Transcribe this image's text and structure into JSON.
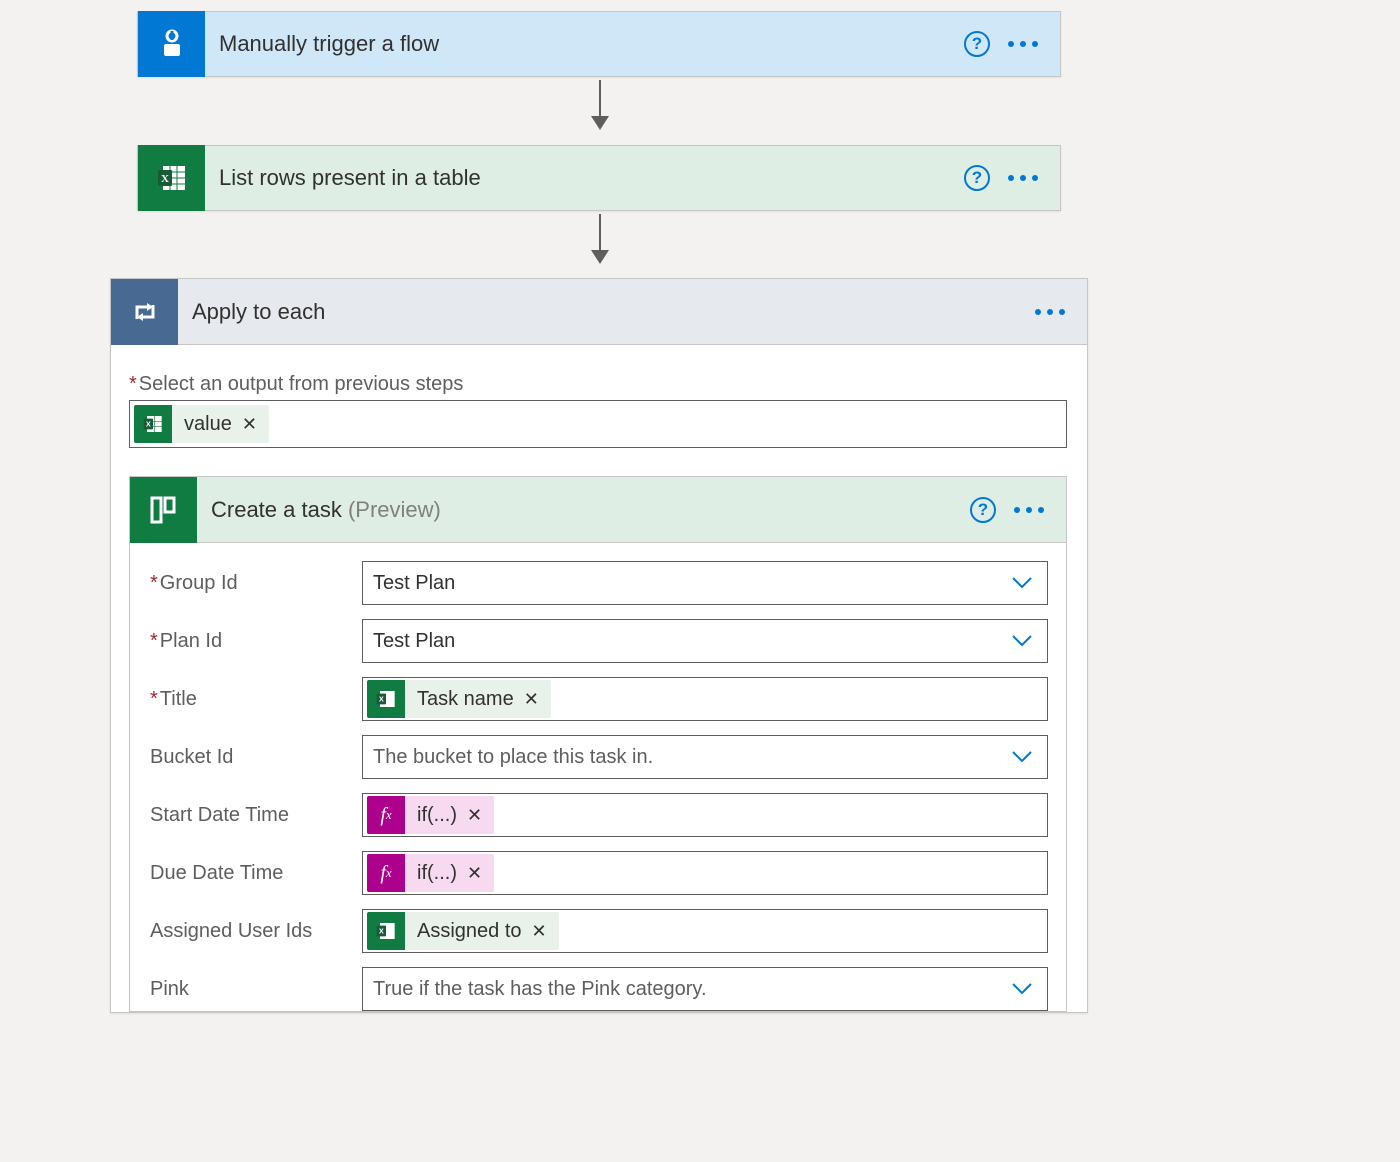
{
  "steps": {
    "trigger": {
      "title": "Manually trigger a flow"
    },
    "listRows": {
      "title": "List rows present in a table"
    }
  },
  "applyEach": {
    "title": "Apply to each",
    "selectLabel": "Select an output from previous steps",
    "selectToken": "value"
  },
  "createTask": {
    "title": "Create a task ",
    "previewTag": "(Preview)",
    "fields": {
      "groupId": {
        "label": "Group Id",
        "value": "Test Plan"
      },
      "planId": {
        "label": "Plan Id",
        "value": "Test Plan"
      },
      "title": {
        "label": "Title",
        "token": "Task name"
      },
      "bucketId": {
        "label": "Bucket Id",
        "placeholder": "The bucket to place this task in."
      },
      "startDate": {
        "label": "Start Date Time",
        "token": "if(...)"
      },
      "dueDate": {
        "label": "Due Date Time",
        "token": "if(...)"
      },
      "assigned": {
        "label": "Assigned User Ids",
        "token": "Assigned to"
      },
      "pink": {
        "label": "Pink",
        "placeholder": "True if the task has the Pink category."
      }
    }
  }
}
